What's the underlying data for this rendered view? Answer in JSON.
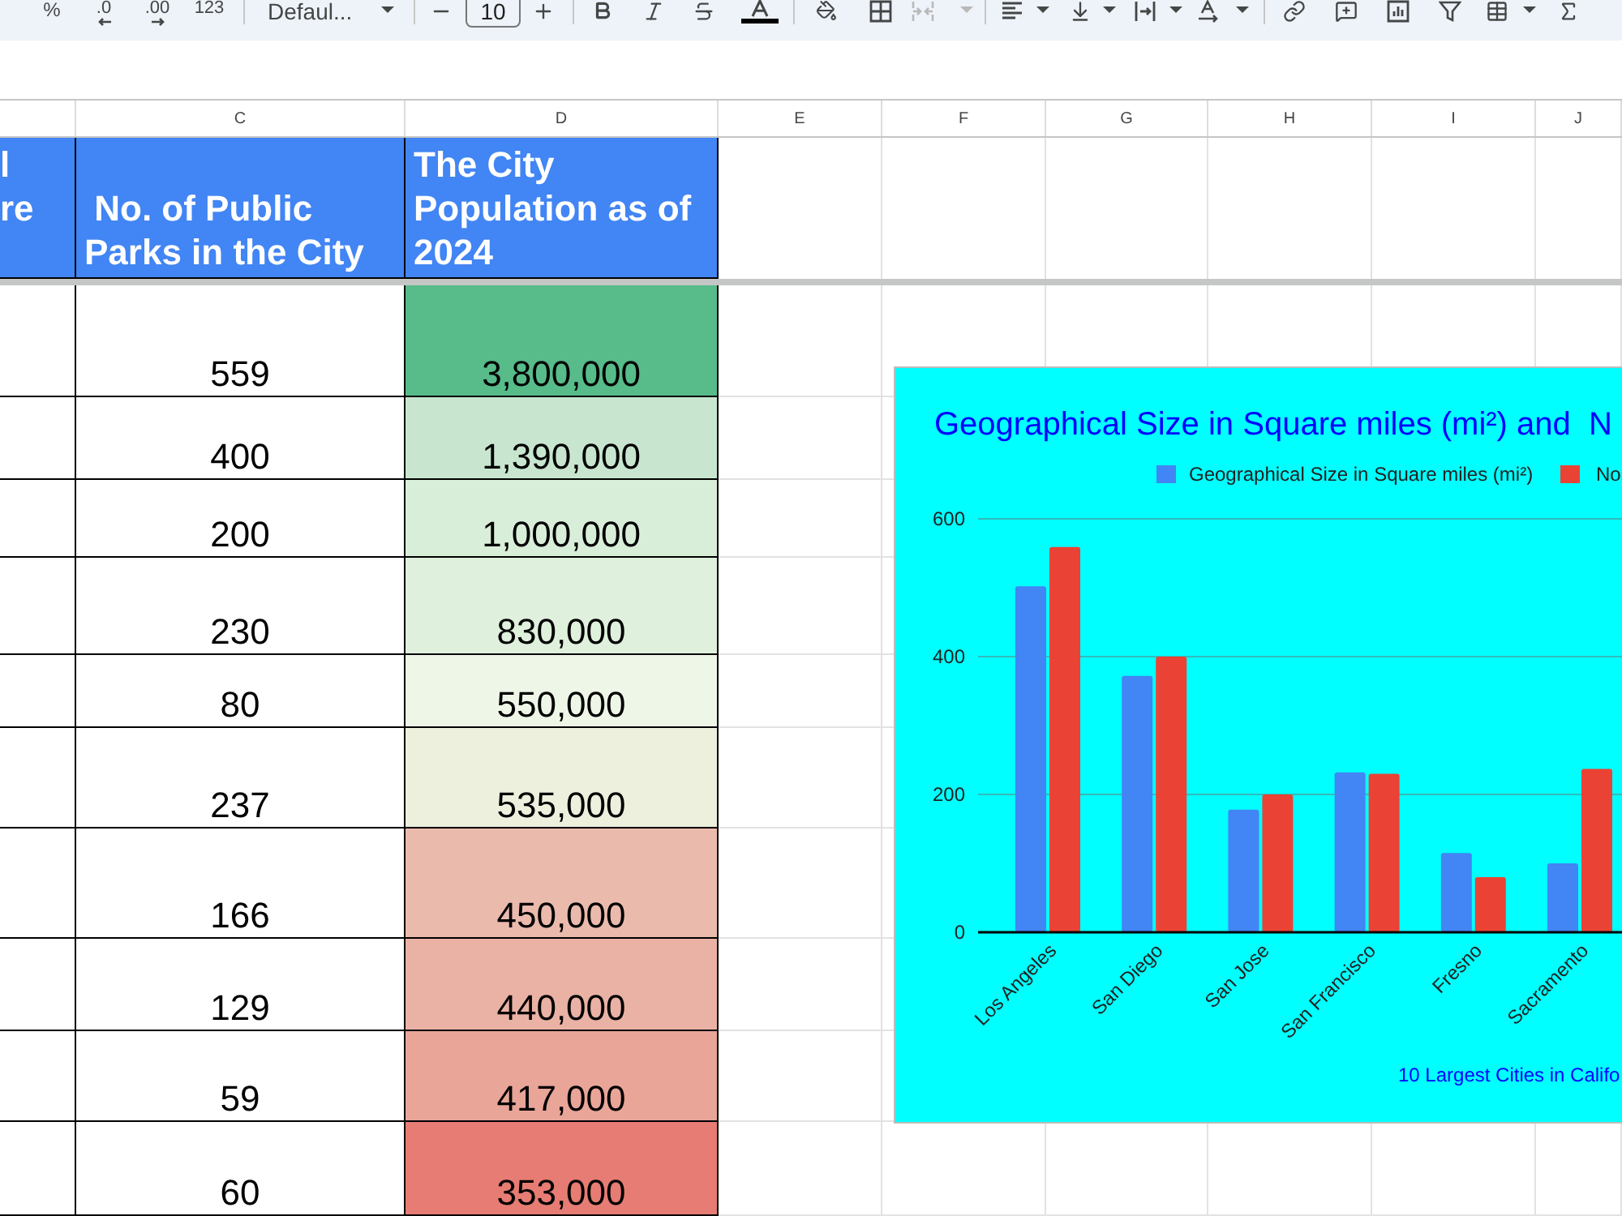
{
  "toolbar": {
    "percent": "%",
    "decrease_decimal": ".0",
    "increase_decimal": ".00",
    "number_format": "123",
    "font": "Defaul...",
    "font_size": "10",
    "merge_disabled": true
  },
  "columns": [
    "C",
    "D",
    "E",
    "F",
    "G",
    "H",
    "I",
    "J"
  ],
  "table": {
    "headers": {
      "column_b": [
        "l",
        "re"
      ],
      "parks": " No. of Public Parks in the City",
      "population": "The City Population as of 2024"
    },
    "rows": [
      {
        "parks": "559",
        "population": "3,800,000",
        "color": "#57bb8a"
      },
      {
        "parks": "400",
        "population": "1,390,000",
        "color": "#c8e6cf"
      },
      {
        "parks": "200",
        "population": "1,000,000",
        "color": "#d9eed9"
      },
      {
        "parks": "230",
        "population": "830,000",
        "color": "#dff0dc"
      },
      {
        "parks": "80",
        "population": "550,000",
        "color": "#eef6e7"
      },
      {
        "parks": "237",
        "population": "535,000",
        "color": "#ecf0dd"
      },
      {
        "parks": "166",
        "population": "450,000",
        "color": "#eabaad"
      },
      {
        "parks": "129",
        "population": "440,000",
        "color": "#e9b2a4"
      },
      {
        "parks": "59",
        "population": "417,000",
        "color": "#e8a598"
      },
      {
        "parks": "60",
        "population": "353,000",
        "color": "#e67c73"
      }
    ]
  },
  "chart": {
    "chart_data": {
      "type": "bar",
      "title": "Geographical Size in Square miles (mi²) and  N",
      "legend": "top",
      "xlabel": "10 Largest Cities in Califo",
      "categories": [
        "Los Angeles",
        "San Diego",
        "San Jose",
        "San Francisco",
        "Fresno",
        "Sacramento"
      ],
      "series": [
        {
          "name": "Geographical Size in Square miles (mi²)",
          "color": "#4285f4",
          "values": [
            502,
            372,
            178,
            232,
            115,
            100
          ]
        },
        {
          "name": "No",
          "color": "#ea4335",
          "values": [
            559,
            400,
            200,
            230,
            80,
            237
          ]
        }
      ],
      "ylim": [
        0,
        600
      ],
      "yticks": [
        0,
        200,
        400,
        600
      ]
    }
  }
}
